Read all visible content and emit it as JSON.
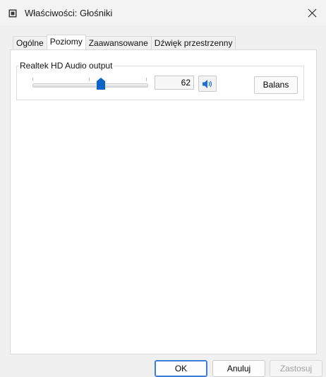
{
  "window": {
    "title": "Właściwości: Głośniki"
  },
  "tabs": [
    {
      "label": "Ogólne"
    },
    {
      "label": "Poziomy"
    },
    {
      "label": "Zaawansowane"
    },
    {
      "label": "Dźwięk przestrzenny"
    }
  ],
  "levels": {
    "device_label": "Realtek HD Audio output",
    "volume_value": "62",
    "volume_level": 0.62,
    "balance_label": "Balans",
    "mute_icon": "speaker-icon"
  },
  "footer": {
    "ok_label": "OK",
    "cancel_label": "Anuluj",
    "apply_label": "Zastosuj"
  },
  "colors": {
    "accent": "#0a64c8",
    "ok_border": "#3b7dd8"
  }
}
